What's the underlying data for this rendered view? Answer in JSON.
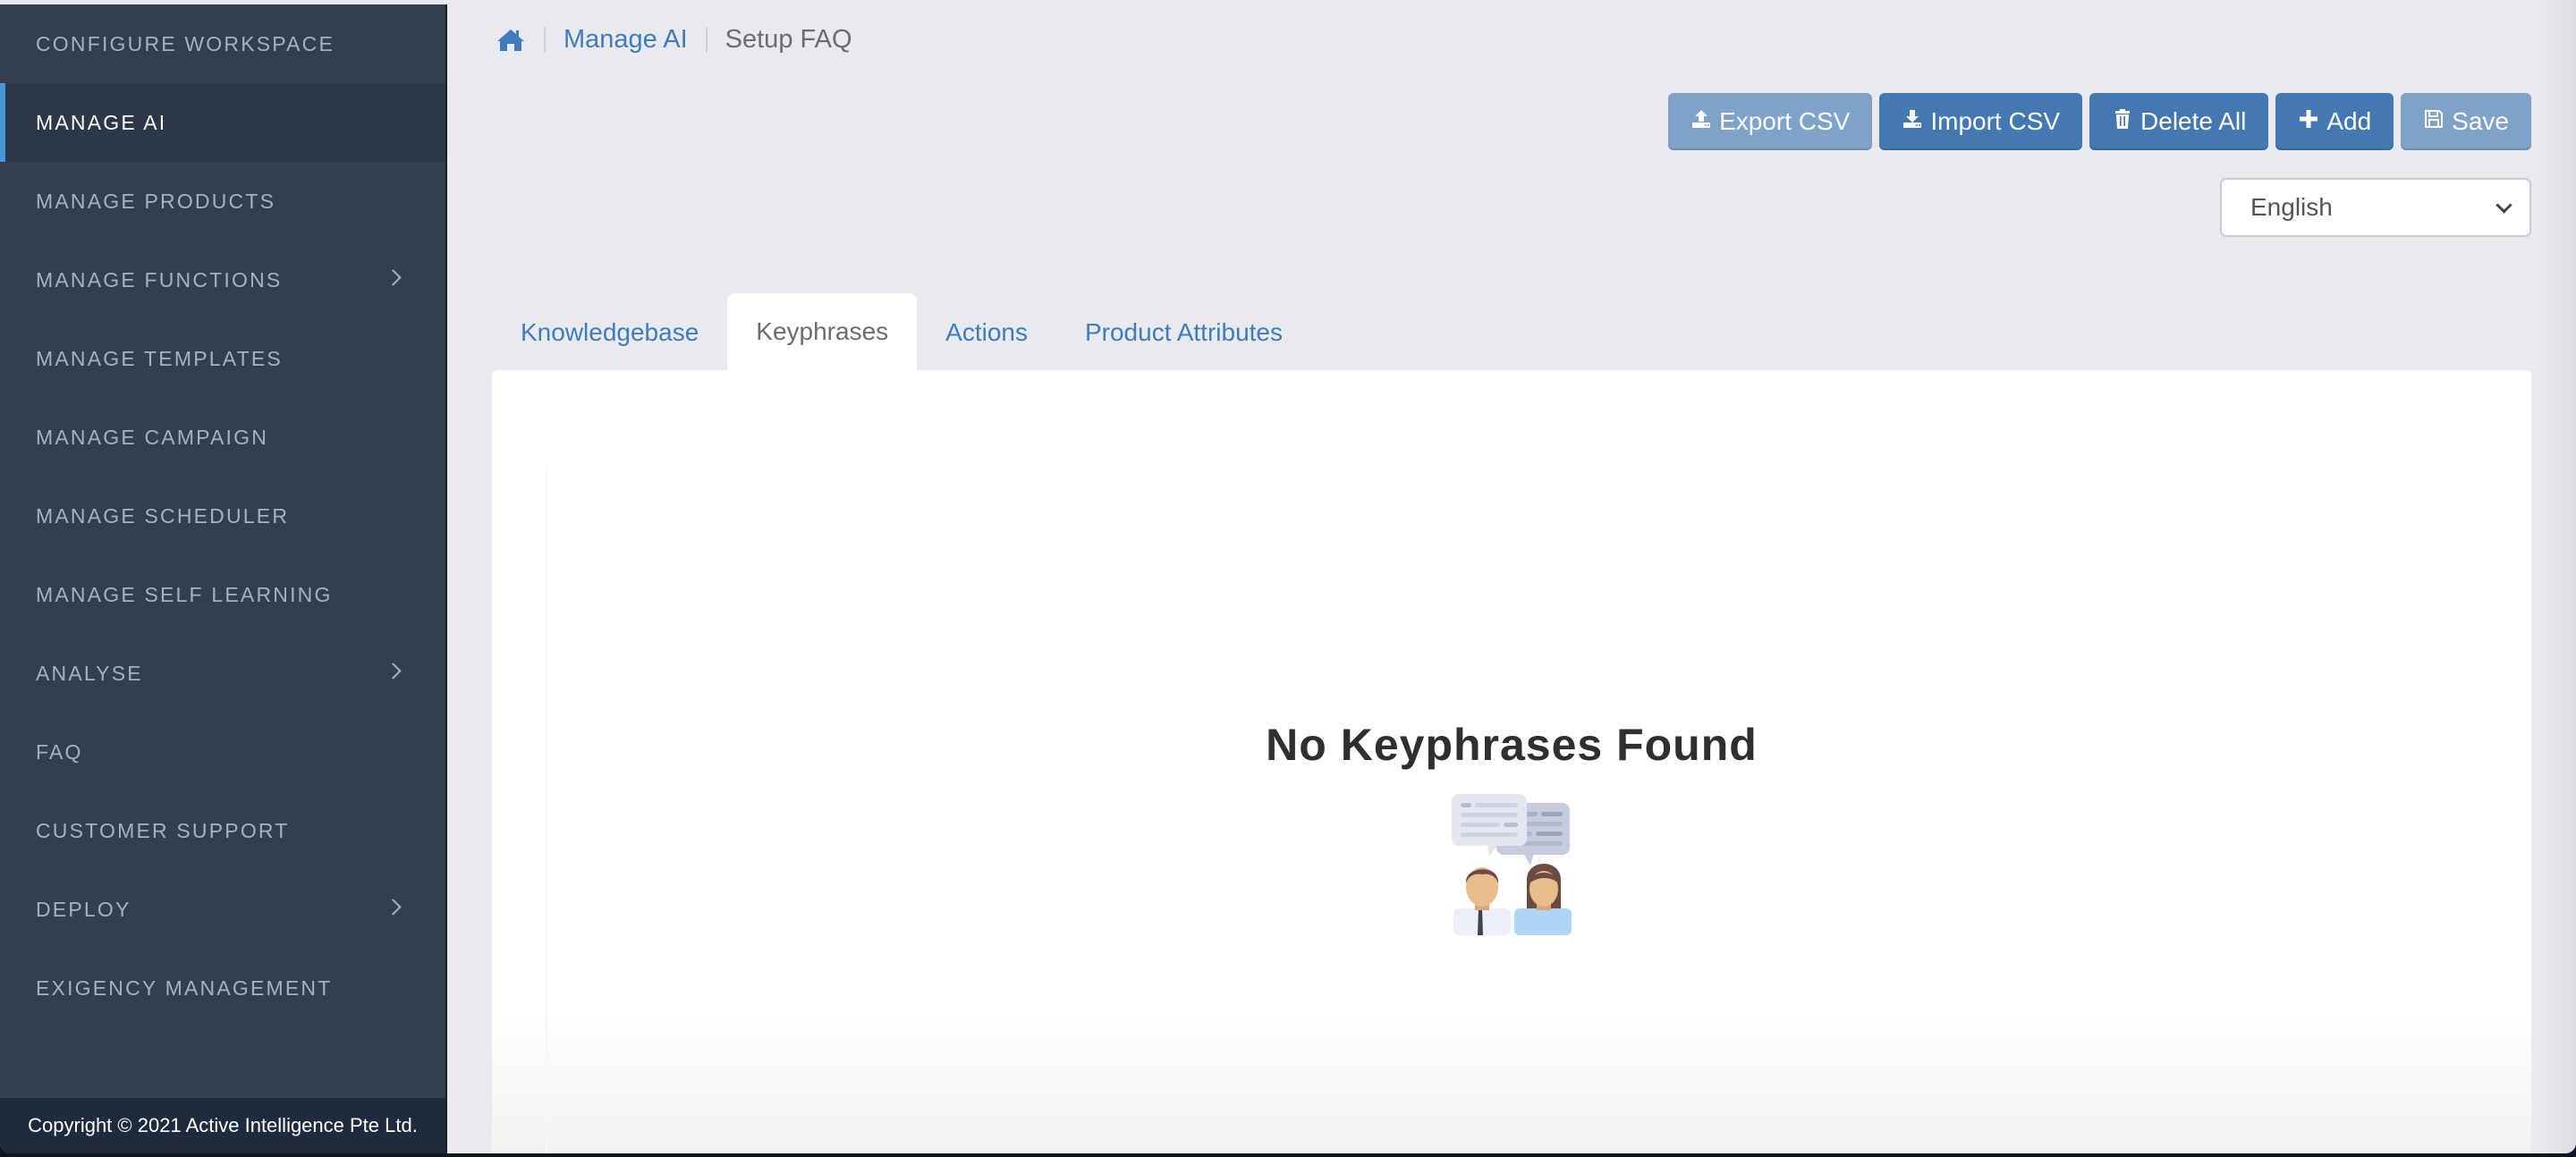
{
  "sidebar": {
    "items": [
      {
        "label": "CONFIGURE WORKSPACE",
        "active": false,
        "has_submenu": false
      },
      {
        "label": "MANAGE AI",
        "active": true,
        "has_submenu": false
      },
      {
        "label": "MANAGE PRODUCTS",
        "active": false,
        "has_submenu": false
      },
      {
        "label": "MANAGE FUNCTIONS",
        "active": false,
        "has_submenu": true
      },
      {
        "label": "MANAGE TEMPLATES",
        "active": false,
        "has_submenu": false
      },
      {
        "label": "MANAGE CAMPAIGN",
        "active": false,
        "has_submenu": false
      },
      {
        "label": "MANAGE SCHEDULER",
        "active": false,
        "has_submenu": false
      },
      {
        "label": "MANAGE SELF LEARNING",
        "active": false,
        "has_submenu": false
      },
      {
        "label": "ANALYSE",
        "active": false,
        "has_submenu": true
      },
      {
        "label": "FAQ",
        "active": false,
        "has_submenu": false
      },
      {
        "label": "CUSTOMER SUPPORT",
        "active": false,
        "has_submenu": false
      },
      {
        "label": "DEPLOY",
        "active": false,
        "has_submenu": true
      },
      {
        "label": "EXIGENCY MANAGEMENT",
        "active": false,
        "has_submenu": false
      }
    ],
    "footer": "Copyright © 2021 Active Intelligence Pte Ltd."
  },
  "breadcrumb": {
    "home_icon": "home-icon",
    "items": [
      {
        "label": "Manage AI",
        "link": true
      },
      {
        "label": "Setup FAQ",
        "link": false
      }
    ]
  },
  "toolbar": {
    "buttons": [
      {
        "label": "Export CSV",
        "icon": "upload-icon",
        "state": "disabled"
      },
      {
        "label": "Import CSV",
        "icon": "download-icon",
        "state": "enabled"
      },
      {
        "label": "Delete All",
        "icon": "trash-icon",
        "state": "enabled"
      },
      {
        "label": "Add",
        "icon": "plus-icon",
        "state": "enabled"
      },
      {
        "label": "Save",
        "icon": "floppy-disk-icon",
        "state": "disabled"
      }
    ]
  },
  "language_select": {
    "selected": "English"
  },
  "tabs": [
    {
      "label": "Knowledgebase",
      "active": false
    },
    {
      "label": "Keyphrases",
      "active": true
    },
    {
      "label": "Actions",
      "active": false
    },
    {
      "label": "Product Attributes",
      "active": false
    }
  ],
  "empty_state": {
    "title": "No Keyphrases Found",
    "illustration": "conversation-people-icon"
  },
  "colors": {
    "sidebar_bg": "#333f50",
    "sidebar_active_bg": "#2c3747",
    "active_indicator": "#4a96d8",
    "primary_button": "#4378b1",
    "disabled_button": "#7fa2c8",
    "link": "#3f7bbd",
    "page_bg": "#e9eaee"
  }
}
